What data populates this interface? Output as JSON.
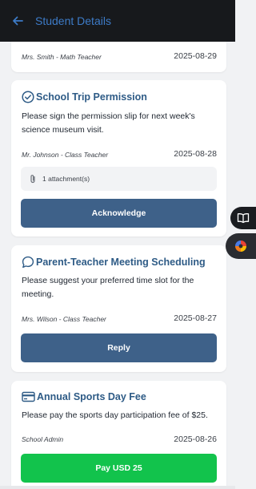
{
  "header": {
    "title": "Student Details",
    "back_icon": "arrow-left-icon"
  },
  "messages": [
    {
      "sender": "Mrs. Smith - Math Teacher",
      "date": "2025-08-29"
    },
    {
      "icon": "check-circle-icon",
      "title": "School Trip Permission",
      "message": "Please sign the permission slip for next week's science museum visit.",
      "sender": "Mr. Johnson - Class Teacher",
      "date": "2025-08-28",
      "attachment_label": "1 attachment(s)",
      "action_label": "Acknowledge"
    },
    {
      "icon": "chat-bubble-icon",
      "title": "Parent-Teacher Meeting Scheduling",
      "message": "Please suggest your preferred time slot for the meeting.",
      "sender": "Mrs. Wilson - Class Teacher",
      "date": "2025-08-27",
      "action_label": "Reply"
    },
    {
      "icon": "credit-card-icon",
      "title": "Annual Sports Day Fee",
      "message": "Please pay the sports day participation fee of $25.",
      "sender": "School Admin",
      "date": "2025-08-26",
      "action_label": "Pay USD 25"
    }
  ],
  "colors": {
    "appbar_bg": "#17191c",
    "title_blue": "#3d7bc7",
    "card_title": "#2e5b86",
    "action_blue": "#3e6189",
    "pay_green": "#12c34c"
  }
}
